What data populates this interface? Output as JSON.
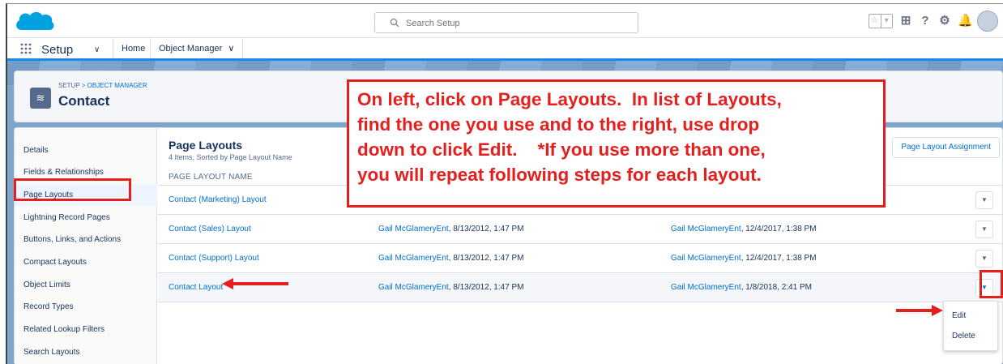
{
  "global_header": {
    "search_placeholder": "Search Setup"
  },
  "nav": {
    "app_name": "Setup",
    "home_tab": "Home",
    "object_manager_tab": "Object Manager",
    "object_manager_chevron": "∨"
  },
  "object_header": {
    "breadcrumb_setup": "SETUP",
    "breadcrumb_sep": " > ",
    "breadcrumb_object_manager": "OBJECT MANAGER",
    "title": "Contact"
  },
  "sidebar": {
    "items": [
      {
        "label": "Details"
      },
      {
        "label": "Fields & Relationships"
      },
      {
        "label": "Page Layouts"
      },
      {
        "label": "Lightning Record Pages"
      },
      {
        "label": "Buttons, Links, and Actions"
      },
      {
        "label": "Compact Layouts"
      },
      {
        "label": "Object Limits"
      },
      {
        "label": "Record Types"
      },
      {
        "label": "Related Lookup Filters"
      },
      {
        "label": "Search Layouts"
      }
    ]
  },
  "content": {
    "title": "Page Layouts",
    "subtitle": "4 Items, Sorted by Page Layout Name",
    "assignment_button": "Page Layout Assignment",
    "column_header": "PAGE LAYOUT NAME",
    "rows": [
      {
        "name": "Contact (Marketing) Layout",
        "created_by": "",
        "created_at": "",
        "modified_by": "",
        "modified_at": ""
      },
      {
        "name": "Contact (Sales) Layout",
        "created_by": "Gail McGlameryEnt",
        "created_at": ", 8/13/2012, 1:47 PM",
        "modified_by": "Gail McGlameryEnt",
        "modified_at": ", 12/4/2017, 1:38 PM"
      },
      {
        "name": "Contact (Support) Layout",
        "created_by": "Gail McGlameryEnt",
        "created_at": ", 8/13/2012, 1:47 PM",
        "modified_by": "Gail McGlameryEnt",
        "modified_at": ", 12/4/2017, 1:38 PM"
      },
      {
        "name": "Contact Layout",
        "created_by": "Gail McGlameryEnt",
        "created_at": ", 8/13/2012, 1:47 PM",
        "modified_by": "Gail McGlameryEnt",
        "modified_at": ", 1/8/2018, 2:41 PM"
      }
    ]
  },
  "row_menu": {
    "edit": "Edit",
    "delete": "Delete"
  },
  "annotation": {
    "line1": "On left, click on Page Layouts.  In list of Layouts,",
    "line2": "find the one you use and to the right, use drop",
    "line3": "down to click Edit.    *If you use more than one,",
    "line4": "you will repeat following steps for each layout."
  },
  "colors": {
    "brand_blue": "#1589ee",
    "link_blue": "#0070d2",
    "annotation_red": "#e4201f",
    "header_band": "#7ea5cc"
  }
}
